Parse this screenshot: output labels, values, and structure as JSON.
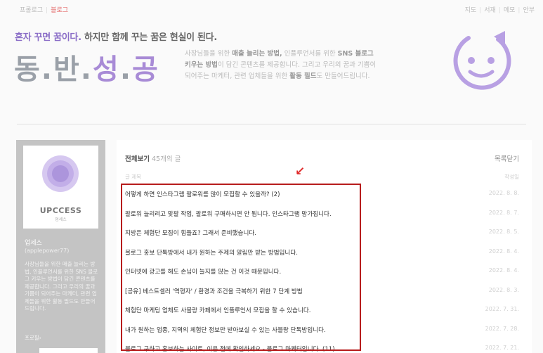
{
  "topbar": {
    "left": [
      "프롤로그",
      "블로그"
    ],
    "right": [
      "지도",
      "서재",
      "메모",
      "안부"
    ]
  },
  "header": {
    "tagline_a": "혼자 꾸면 꿈이다.",
    "tagline_b": " 하지만 함께 꾸는 꿈은 현실이 된다.",
    "logo_gray": "동.반.",
    "logo_purple": "성",
    "logo_dot": ".",
    "logo_gray2": "공",
    "desc_1": "사장님들을 위한 ",
    "desc_1b": "매출 늘리는 방법,",
    "desc_1c": " 인플루언서를 위한 ",
    "desc_1d": "SNS 블로그",
    "desc_2": "키우는 방법",
    "desc_2b": "이 담긴 콘텐츠를 제공합니다. 그리고 우리의 꿈과 기쁨이",
    "desc_3": "되어주는 마케터, 관련 업체들을 위한 ",
    "desc_3b": "활동 필드",
    "desc_3c": "도 만들어드립니다.",
    "accent_color": "#a88bd6",
    "icon": "smiley-logo"
  },
  "sidebar": {
    "brand": "UPCCESS",
    "brand_sub": "업세스",
    "name": "업세스",
    "id": "(applepower77)",
    "intro": "사장님들을 위한 매출 늘리는 방법, 인플루언서를 위한 SNS 블로그 키우는 방법이 담긴 콘텐츠를 제공합니다. 그리고 우리의 꿈과 기쁨이 되어주는 마케터, 관련 업체들을 위한 활동 필드도 만들어드립니다.",
    "profile": "프로필›"
  },
  "main": {
    "heading": "전체보기",
    "count": " 45개의 글",
    "close": "목록닫기",
    "col_title": "글 제목",
    "col_date": "작성일",
    "arrow": "↙",
    "posts": [
      {
        "title": "어떻게 하면 인스타그램 팔로워를 많이 모집할 수 있을까? (2)",
        "date": "2022. 8. 8."
      },
      {
        "title": "팔로워 늘리려고 맞팔 작업, 팔로워 구매하시면 안 됩니다. 인스타그램 망가집니다.",
        "date": "2022. 8. 7."
      },
      {
        "title": "지방은 체험단 모집이 힘들죠? 그래서 준비했습니다.",
        "date": "2022. 8. 5."
      },
      {
        "title": "블로그 홍보 단톡방에서 내가 원하는 주제의 알림만 받는 방법입니다.",
        "date": "2022. 8. 4."
      },
      {
        "title": "인터넷에 광고를 해도 손님이 늘지를 않는 건 이것 때문입니다.",
        "date": "2022. 8. 4."
      },
      {
        "title": "[공유] 베스트셀러 '역행자' / 환경과 조건을 극복하기 위한 7 단계 방법",
        "date": "2022. 8. 3."
      },
      {
        "title": "체험단 마케팅 업체도 사블랑 카페에서 인플루언서 모집을 할 수 있습니다.",
        "date": "2022. 7. 31."
      },
      {
        "title": "내가 원하는 업종, 지역의 체험단 정보만 받아보실 수 있는 사블랑 단톡방입니다.",
        "date": "2022. 7. 28."
      },
      {
        "title": "블로그 구하고 홍보하는 사이트, 이용 전에 확인하세요 - 블로그 마케터입니다. (11)",
        "date": "2022. 7. 21."
      }
    ]
  }
}
